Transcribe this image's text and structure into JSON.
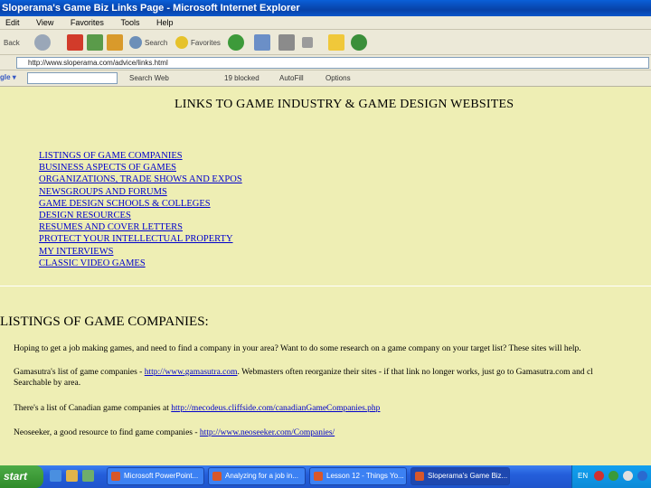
{
  "window": {
    "title": "Sloperama's Game Biz Links Page - Microsoft Internet Explorer"
  },
  "menu": [
    "Edit",
    "View",
    "Favorites",
    "Tools",
    "Help"
  ],
  "toolbar": {
    "back": "Back",
    "search": "Search",
    "favorites": "Favorites"
  },
  "address": {
    "url": "http://www.sloperama.com/advice/links.html"
  },
  "google_bar": {
    "search_web": "Search Web",
    "blocked": "19 blocked",
    "autofill": "AutoFill",
    "options": "Options"
  },
  "content": {
    "title": "LINKS TO GAME INDUSTRY & GAME DESIGN WEBSITES",
    "links": [
      "LISTINGS OF GAME COMPANIES",
      "BUSINESS ASPECTS OF GAMES",
      "ORGANIZATIONS, TRADE SHOWS AND EXPOS",
      "NEWSGROUPS AND FORUMS",
      "GAME DESIGN SCHOOLS & COLLEGES",
      "DESIGN RESOURCES",
      "RESUMES AND COVER LETTERS",
      "PROTECT YOUR INTELLECTUAL PROPERTY",
      "MY INTERVIEWS",
      "CLASSIC VIDEO GAMES"
    ],
    "section_title": "LISTINGS OF GAME COMPANIES:",
    "para1": "Hoping to get a job making games, and need to find a company in your area? Want to do some research on a game company on your target list? These sites will help.",
    "para2_a": "Gamasutra's list of game companies - ",
    "para2_link": "http://www.gamasutra.com",
    "para2_b": ". Webmasters often reorganize their sites - if that link no longer works, just go to Gamasutra.com and cl",
    "para2_c": "Searchable by area.",
    "para3_a": "There's a list of Canadian game companies at ",
    "para3_link": "http://mecodeus.cliffside.com/canadianGameCompanies.php",
    "para4_a": "Neoseeker, a good resource to find game companies - ",
    "para4_link": "http://www.neoseeker.com/Companies/"
  },
  "taskbar": {
    "start": "start",
    "tasks": [
      "Microsoft PowerPoint...",
      "Analyzing for a job in...",
      "Lesson 12 - Things Yo...",
      "Sloperama's Game Biz..."
    ],
    "lang": "EN"
  },
  "colors": {
    "page_bg": "#eeeeb4",
    "link": "#0000cc",
    "title_bar": "#0842a8",
    "chrome": "#ece9d8"
  }
}
